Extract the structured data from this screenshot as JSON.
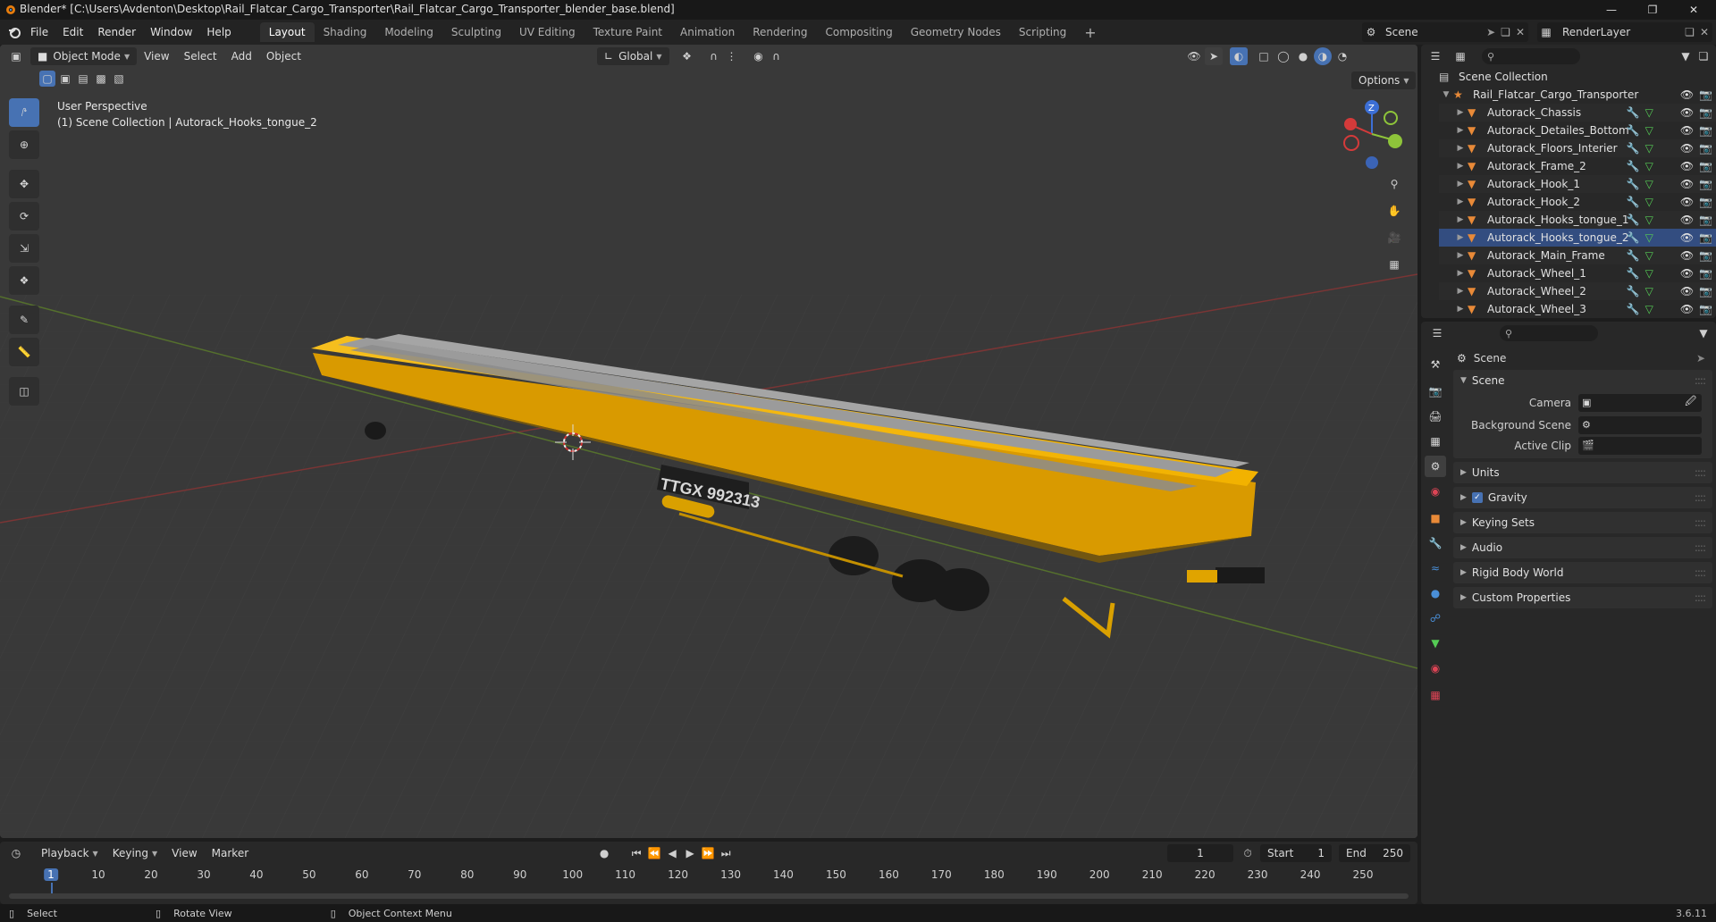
{
  "window": {
    "title": "Blender* [C:\\Users\\Avdenton\\Desktop\\Rail_Flatcar_Cargo_Transporter\\Rail_Flatcar_Cargo_Transporter_blender_base.blend]"
  },
  "menu": [
    "File",
    "Edit",
    "Render",
    "Window",
    "Help"
  ],
  "workspaces": [
    "Layout",
    "Shading",
    "Modeling",
    "Sculpting",
    "UV Editing",
    "Texture Paint",
    "Animation",
    "Rendering",
    "Compositing",
    "Geometry Nodes",
    "Scripting"
  ],
  "active_workspace": "Layout",
  "scene_selector": {
    "scene": "Scene",
    "view_layer": "RenderLayer"
  },
  "viewport": {
    "mode": "Object Mode",
    "menus": [
      "View",
      "Select",
      "Add",
      "Object"
    ],
    "transform_orientation": "Global",
    "options_label": "Options",
    "overlay_line1": "User Perspective",
    "overlay_line2": "(1) Scene Collection | Autorack_Hooks_tongue_2",
    "car_number": "TTGX 992313"
  },
  "outliner": {
    "root": "Scene Collection",
    "collection": "Rail_Flatcar_Cargo_Transporter",
    "items": [
      "Autorack_Chassis",
      "Autorack_Detailes_Bottom",
      "Autorack_Floors_Interier",
      "Autorack_Frame_2",
      "Autorack_Hook_1",
      "Autorack_Hook_2",
      "Autorack_Hooks_tongue_1",
      "Autorack_Hooks_tongue_2",
      "Autorack_Main_Frame",
      "Autorack_Wheel_1",
      "Autorack_Wheel_2",
      "Autorack_Wheel_3"
    ],
    "selected_index": 7
  },
  "properties": {
    "context_title": "Scene",
    "scene_panel": "Scene",
    "camera_label": "Camera",
    "background_scene_label": "Background Scene",
    "active_clip_label": "Active Clip",
    "panels": [
      "Units",
      "Gravity",
      "Keying Sets",
      "Audio",
      "Rigid Body World",
      "Custom Properties"
    ]
  },
  "timeline": {
    "menus": [
      "Playback",
      "Keying",
      "View",
      "Marker"
    ],
    "current_frame": "1",
    "start_label": "Start",
    "start": "1",
    "end_label": "End",
    "end": "250",
    "ticks": [
      "1",
      "10",
      "20",
      "30",
      "40",
      "50",
      "60",
      "70",
      "80",
      "90",
      "100",
      "110",
      "120",
      "130",
      "140",
      "150",
      "160",
      "170",
      "180",
      "190",
      "200",
      "210",
      "220",
      "230",
      "240",
      "250"
    ]
  },
  "status": {
    "select": "Select",
    "rotate": "Rotate View",
    "context_menu": "Object Context Menu",
    "version": "3.6.11"
  },
  "colors": {
    "accent": "#4772b3",
    "wagon_yellow": "#f2b200",
    "mesh_orange": "#e98a38"
  }
}
